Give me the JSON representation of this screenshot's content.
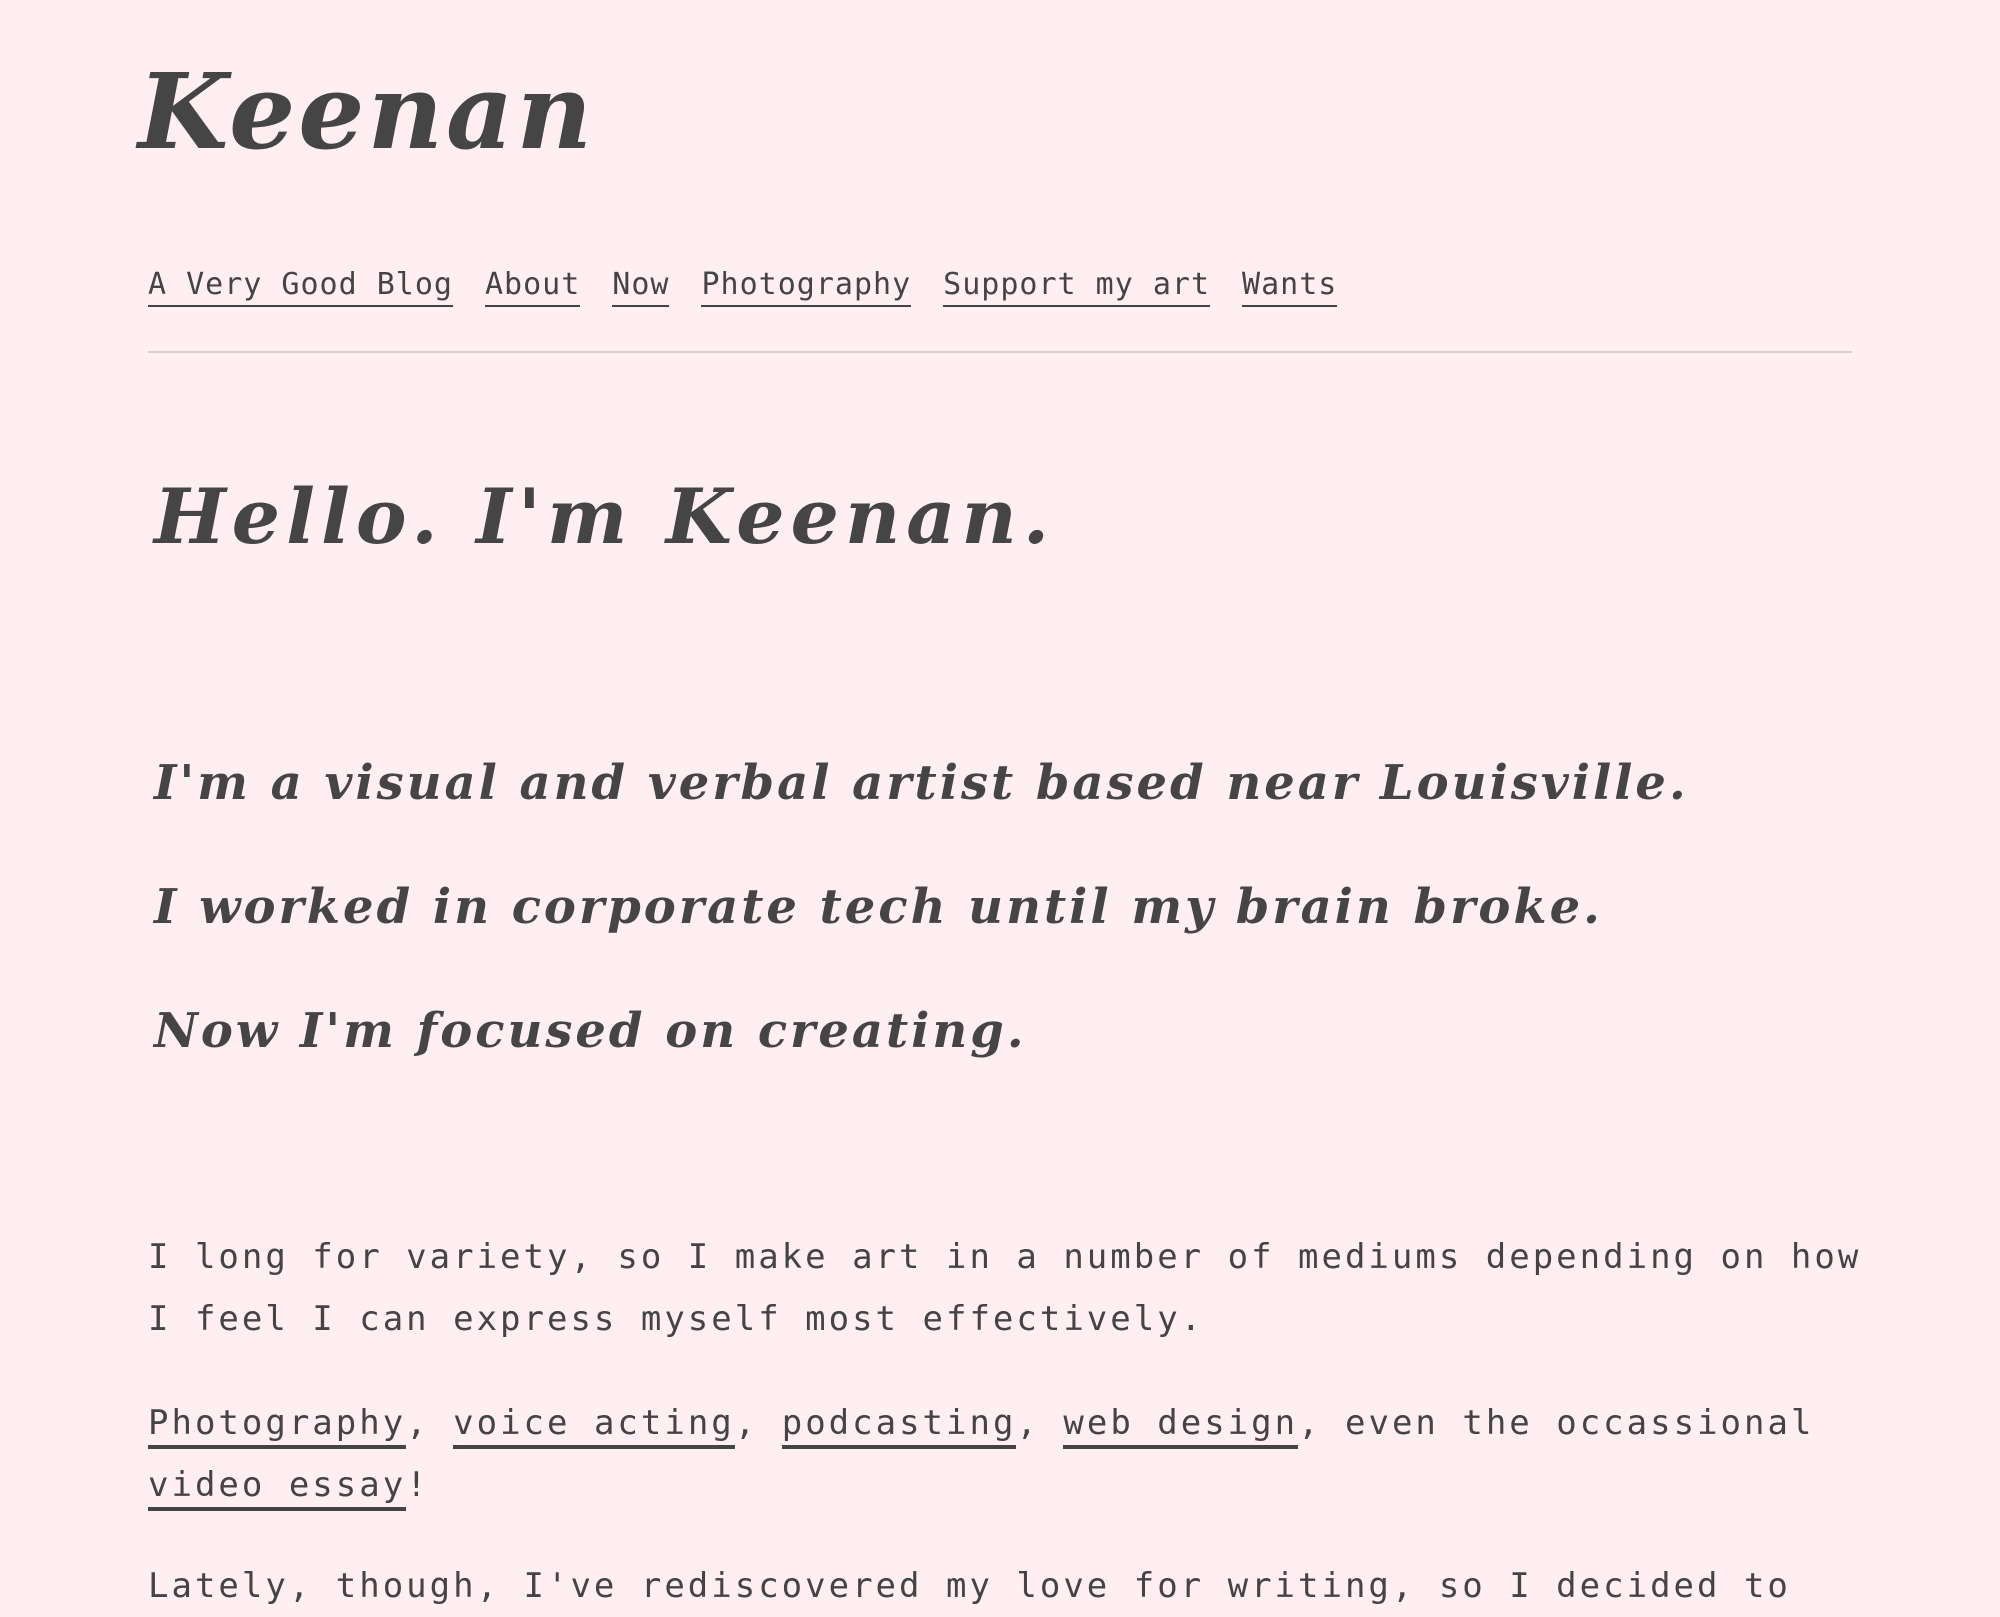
{
  "site": {
    "title": "Keenan"
  },
  "nav": {
    "items": [
      {
        "label": "A Very Good Blog"
      },
      {
        "label": "About"
      },
      {
        "label": "Now"
      },
      {
        "label": "Photography"
      },
      {
        "label": "Support my art"
      },
      {
        "label": "Wants"
      }
    ]
  },
  "hero": {
    "heading": "Hello. I'm Keenan."
  },
  "lead": {
    "line1": "I'm a visual and verbal artist based near Louisville.",
    "line2": "I worked in corporate tech until my brain broke.",
    "line3": "Now I'm focused on creating."
  },
  "body": {
    "p1": "I long for variety, so I make art in a number of mediums depending on how I feel I can express myself most effectively.",
    "p2": {
      "link_photography": "Photography",
      "sep1": ", ",
      "link_voice_acting": "voice acting",
      "sep2": ", ",
      "link_podcasting": "podcasting",
      "sep3": ", ",
      "link_web_design": "web design",
      "middle": ", even the occassional ",
      "link_video_essay": "video essay",
      "end": "!"
    },
    "p3": "Lately, though, I've rediscovered my love for writing, so I decided to"
  }
}
